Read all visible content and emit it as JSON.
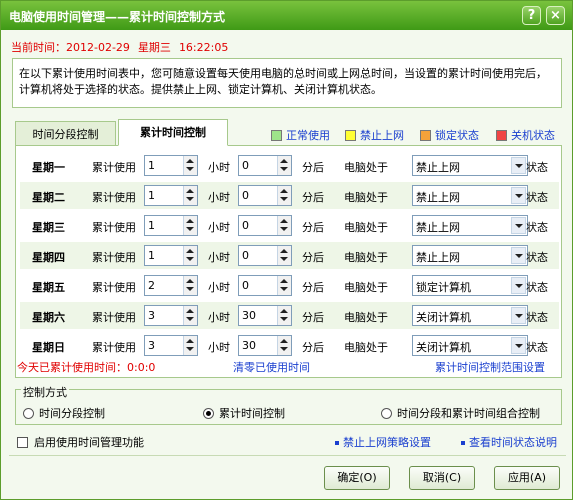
{
  "window": {
    "title": "电脑使用时间管理——累计时间控制方式",
    "help_icon": "question-icon",
    "close_icon": "close-icon"
  },
  "datetime": {
    "label": "当前时间：",
    "date": "2012-02-29",
    "weekday": "星期三",
    "time": "16:22:05"
  },
  "description": "在以下累计使用时间表中，您可随意设置每天使用电脑的总时间或上网总时间，当设置的累计时间使用完后，计算机将处于选择的状态。提供禁止上网、锁定计算机、关闭计算机状态。",
  "tabs": [
    {
      "label": "时间分段控制",
      "active": false
    },
    {
      "label": "累计时间控制",
      "active": true
    }
  ],
  "legend": [
    {
      "label": "正常使用",
      "color": "#9ee38a"
    },
    {
      "label": "禁止上网",
      "color": "#ffff33"
    },
    {
      "label": "锁定状态",
      "color": "#f5a23a"
    },
    {
      "label": "关机状态",
      "color": "#f04545"
    }
  ],
  "schedule": {
    "use_label": "累计使用",
    "hour_label": "小时",
    "minute_label": "分后",
    "state_label": "电脑处于",
    "status_label": "状态",
    "rows": [
      {
        "day": "星期一",
        "hours": "1",
        "minutes": "0",
        "state": "禁止上网"
      },
      {
        "day": "星期二",
        "hours": "1",
        "minutes": "0",
        "state": "禁止上网"
      },
      {
        "day": "星期三",
        "hours": "1",
        "minutes": "0",
        "state": "禁止上网"
      },
      {
        "day": "星期四",
        "hours": "1",
        "minutes": "0",
        "state": "禁止上网"
      },
      {
        "day": "星期五",
        "hours": "2",
        "minutes": "0",
        "state": "锁定计算机"
      },
      {
        "day": "星期六",
        "hours": "3",
        "minutes": "30",
        "state": "关闭计算机"
      },
      {
        "day": "星期日",
        "hours": "3",
        "minutes": "30",
        "state": "关闭计算机"
      }
    ]
  },
  "today_usage": "今天已累计使用时间：0:0:0",
  "links": {
    "clear_user_time": "清零已使用时间",
    "range_settings": "累计时间控制范围设置",
    "block_policy": "禁止上网策略设置",
    "view_status": "查看时间状态说明"
  },
  "control_mode": {
    "title": "控制方式",
    "options": [
      {
        "label": "时间分段控制",
        "selected": false
      },
      {
        "label": "累计时间控制",
        "selected": true
      },
      {
        "label": "时间分段和累计时间组合控制",
        "selected": false
      }
    ]
  },
  "enable_checkbox": {
    "label": "启用使用时间管理功能",
    "checked": false
  },
  "buttons": {
    "ok": "确定(O)",
    "cancel": "取消(C)",
    "apply": "应用(A)"
  }
}
